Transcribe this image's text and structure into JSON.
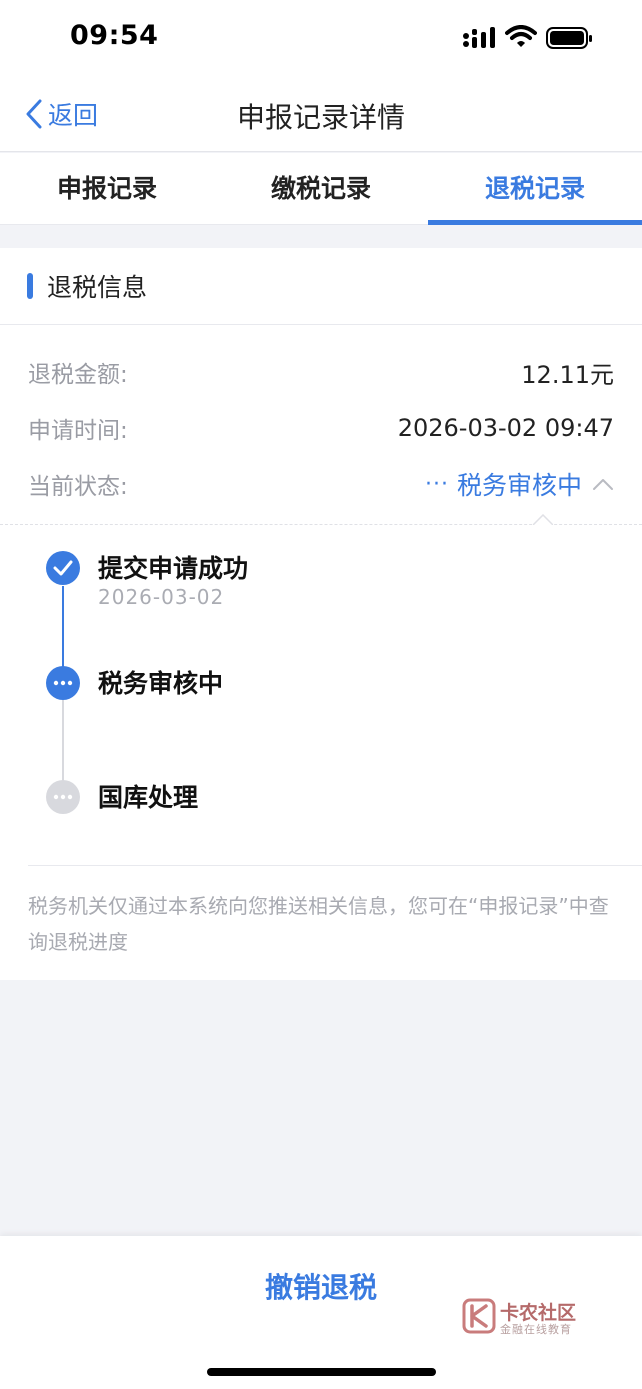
{
  "status_bar": {
    "time": "09:54"
  },
  "nav": {
    "back_label": "返回",
    "title": "申报记录详情"
  },
  "tabs": [
    {
      "label": "申报记录",
      "active": false
    },
    {
      "label": "缴税记录",
      "active": false
    },
    {
      "label": "退税记录",
      "active": true
    }
  ],
  "section": {
    "title": "退税信息"
  },
  "details": [
    {
      "label": "退税金额:",
      "value": "12.11元"
    },
    {
      "label": "申请时间:",
      "value": "2026-03-02 09:47"
    },
    {
      "label": "当前状态:",
      "value": "税务审核中"
    }
  ],
  "status_dots": "···",
  "timeline": [
    {
      "title": "提交申请成功",
      "date": "2026-03-02",
      "state": "done"
    },
    {
      "title": "税务审核中",
      "date": "",
      "state": "current"
    },
    {
      "title": "国库处理",
      "date": "",
      "state": "pending"
    }
  ],
  "notice": "税务机关仅通过本系统向您推送相关信息，您可在“申报记录”中查询退税进度",
  "action": {
    "cancel_label": "撤销退税"
  },
  "watermark": {
    "title": "卡农社区",
    "subtitle": "金融在线教育"
  },
  "colors": {
    "accent": "#3a7be0",
    "pending": "#d8d9de",
    "background": "#f2f3f7"
  }
}
